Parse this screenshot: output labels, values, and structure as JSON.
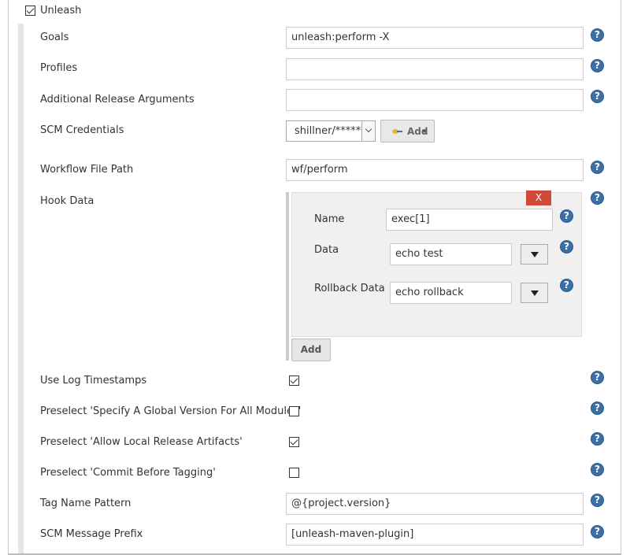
{
  "section": {
    "title": "Unleash",
    "enabled": true
  },
  "fields": {
    "goals": {
      "label": "Goals",
      "value": "unleash:perform -X"
    },
    "profiles": {
      "label": "Profiles",
      "value": ""
    },
    "additional_args": {
      "label": "Additional Release Arguments",
      "value": ""
    },
    "scm_credentials": {
      "label": "SCM Credentials",
      "selected": "shillner/******",
      "add_label": "Add"
    },
    "workflow_path": {
      "label": "Workflow File Path",
      "value": "wf/perform"
    },
    "hook_data": {
      "label": "Hook Data",
      "close_label": "X",
      "name_label": "Name",
      "name_value": "exec[1]",
      "data_label": "Data",
      "data_value": "echo test",
      "rollback_label": "Rollback Data",
      "rollback_value": "echo rollback",
      "add_label": "Add"
    },
    "log_timestamps": {
      "label": "Use Log Timestamps",
      "checked": true
    },
    "global_version": {
      "label": "Preselect 'Specify A Global Version For All Modules'",
      "checked": false
    },
    "local_artifacts": {
      "label": "Preselect 'Allow Local Release Artifacts'",
      "checked": true
    },
    "commit_before_tagging": {
      "label": "Preselect 'Commit Before Tagging'",
      "checked": false
    },
    "tag_pattern": {
      "label": "Tag Name Pattern",
      "value": "@{project.version}"
    },
    "scm_prefix": {
      "label": "SCM Message Prefix",
      "value": "[unleash-maven-plugin]"
    }
  },
  "colors": {
    "help_icon": "#3b6fa5",
    "delete_button": "#d24939"
  },
  "icons": {
    "help": "help-icon",
    "delete": "close-icon",
    "dropdown": "chevron-down-icon",
    "key": "key-icon"
  }
}
